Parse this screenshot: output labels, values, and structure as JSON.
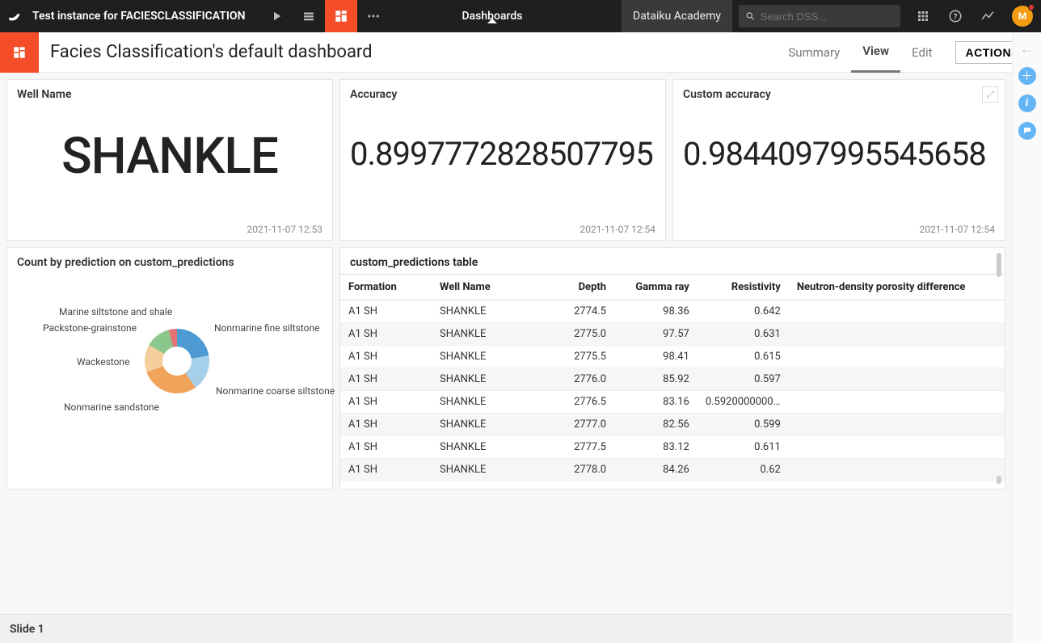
{
  "topbar": {
    "project_name": "Test instance for FACIESCLASSIFICATION",
    "dashboards_label": "Dashboards",
    "academy_label": "Dataiku Academy",
    "search_placeholder": "Search DSS...",
    "avatar_letter": "M"
  },
  "subbar": {
    "title": "Facies Classification's default dashboard",
    "tabs": {
      "summary": "Summary",
      "view": "View",
      "edit": "Edit"
    },
    "actions": "ACTIONS"
  },
  "tiles": {
    "wellname": {
      "title": "Well Name",
      "value": "SHANKLE",
      "ts": "2021-11-07 12:53"
    },
    "accuracy": {
      "title": "Accuracy",
      "value": "0.8997772828507795",
      "ts": "2021-11-07 12:54"
    },
    "custom_accuracy": {
      "title": "Custom accuracy",
      "value": "0.9844097995545658",
      "ts": "2021-11-07 12:54"
    },
    "chart": {
      "title": "Count by prediction on custom_predictions",
      "labels": {
        "marine_siltstone_shale": "Marine siltstone and shale",
        "packstone_grainstone": "Packstone-grainstone",
        "wackestone": "Wackestone",
        "nonmarine_sandstone": "Nonmarine sandstone",
        "nonmarine_fine_siltstone": "Nonmarine fine siltstone",
        "nonmarine_coarse_siltstone": "Nonmarine coarse siltstone"
      }
    },
    "table": {
      "title": "custom_predictions table",
      "columns": [
        "Formation",
        "Well Name",
        "Depth",
        "Gamma ray",
        "Resistivity",
        "Neutron-density porosity difference"
      ],
      "rows": [
        [
          "A1 SH",
          "SHANKLE",
          "2774.5",
          "98.36",
          "0.642",
          ""
        ],
        [
          "A1 SH",
          "SHANKLE",
          "2775.0",
          "97.57",
          "0.631",
          ""
        ],
        [
          "A1 SH",
          "SHANKLE",
          "2775.5",
          "98.41",
          "0.615",
          ""
        ],
        [
          "A1 SH",
          "SHANKLE",
          "2776.0",
          "85.92",
          "0.597",
          ""
        ],
        [
          "A1 SH",
          "SHANKLE",
          "2776.5",
          "83.16",
          "0.59200000000…",
          ""
        ],
        [
          "A1 SH",
          "SHANKLE",
          "2777.0",
          "82.56",
          "0.599",
          ""
        ],
        [
          "A1 SH",
          "SHANKLE",
          "2777.5",
          "83.12",
          "0.611",
          ""
        ],
        [
          "A1 SH",
          "SHANKLE",
          "2778.0",
          "84.26",
          "0.62",
          ""
        ]
      ]
    }
  },
  "chart_data": {
    "type": "pie",
    "title": "Count by prediction on custom_predictions",
    "series": [
      {
        "name": "Nonmarine fine siltstone",
        "value_pct": 22,
        "color": "#4e9bd4"
      },
      {
        "name": "Nonmarine coarse siltstone",
        "value_pct": 18,
        "color": "#a6d0ea"
      },
      {
        "name": "Nonmarine sandstone",
        "value_pct": 29,
        "color": "#f0a35b"
      },
      {
        "name": "Wackestone",
        "value_pct": 14,
        "color": "#f4cf9c"
      },
      {
        "name": "Packstone-grainstone",
        "value_pct": 12,
        "color": "#8bc78b"
      },
      {
        "name": "Marine siltstone and shale",
        "value_pct": 5,
        "color": "#e57373"
      }
    ]
  },
  "footer": {
    "slide_label": "Slide 1"
  }
}
